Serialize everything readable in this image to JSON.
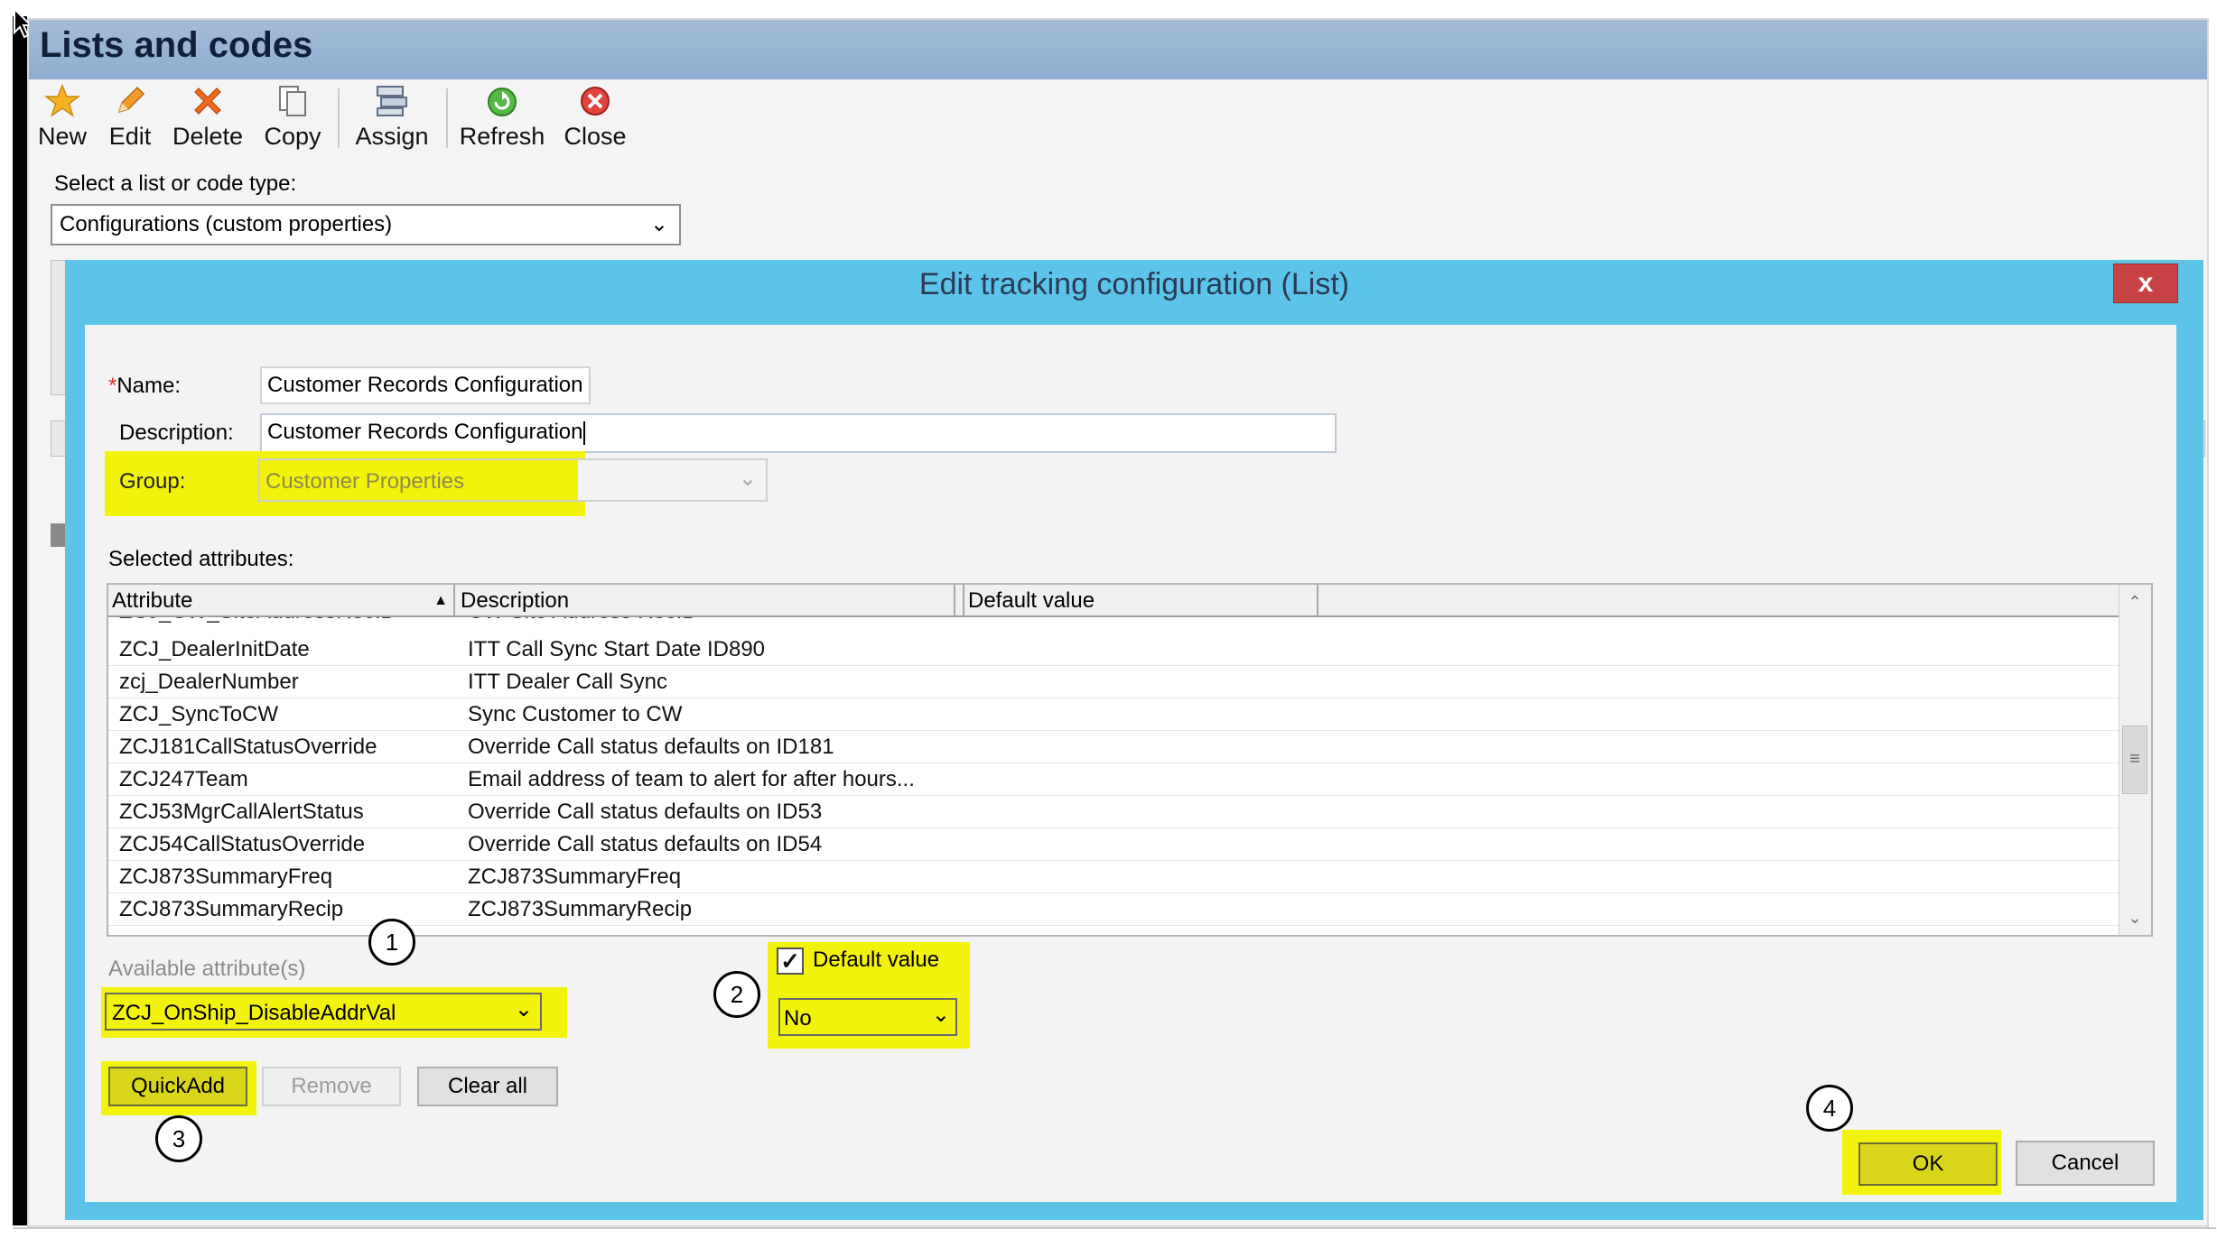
{
  "window": {
    "title": "Lists and codes"
  },
  "toolbar": {
    "new": "New",
    "edit": "Edit",
    "delete": "Delete",
    "copy": "Copy",
    "assign": "Assign",
    "refresh": "Refresh",
    "close": "Close"
  },
  "list_type": {
    "label": "Select a list or code type:",
    "value": "Configurations (custom properties)"
  },
  "dialog": {
    "title": "Edit tracking configuration (List)",
    "close_glyph": "x",
    "name_required_mark": "*",
    "name_label": "Name:",
    "name_value": "Customer Records Configuration",
    "description_label": "Description:",
    "description_value": "Customer Records Configuration",
    "group_label": "Group:",
    "group_value": "Customer Properties",
    "selected_attributes_label": "Selected attributes:",
    "grid": {
      "columns": [
        "Attribute",
        "Description",
        "Default value"
      ],
      "partial_row": {
        "attribute": "ZCJ_CW_SiteAddressRecID",
        "description": "CW Site Address RecID"
      },
      "rows": [
        {
          "attribute": "ZCJ_DealerInitDate",
          "description": "ITT Call Sync Start Date ID890"
        },
        {
          "attribute": "zcj_DealerNumber",
          "description": "ITT Dealer Call Sync"
        },
        {
          "attribute": "ZCJ_SyncToCW",
          "description": "Sync Customer to CW"
        },
        {
          "attribute": "ZCJ181CallStatusOverride",
          "description": "Override Call status defaults on ID181"
        },
        {
          "attribute": "ZCJ247Team",
          "description": "Email address of team to alert for after hours..."
        },
        {
          "attribute": "ZCJ53MgrCallAlertStatus",
          "description": "Override Call status defaults on ID53"
        },
        {
          "attribute": "ZCJ54CallStatusOverride",
          "description": "Override Call status defaults on ID54"
        },
        {
          "attribute": "ZCJ873SummaryFreq",
          "description": "ZCJ873SummaryFreq"
        },
        {
          "attribute": "ZCJ873SummaryRecip",
          "description": "ZCJ873SummaryRecip"
        }
      ]
    },
    "available_label": "Available attribute(s)",
    "available_value": "ZCJ_OnShip_DisableAddrVal",
    "default_value_checkbox_label": "Default value",
    "default_value_checked": true,
    "default_value_select": "No",
    "quickadd_label": "QuickAdd",
    "remove_label": "Remove",
    "clear_all_label": "Clear all",
    "ok_label": "OK",
    "cancel_label": "Cancel"
  },
  "callouts": [
    "1",
    "2",
    "3",
    "4"
  ],
  "colors": {
    "title_bar": "#9fb8d6",
    "dialog_frame": "#5cc4e8",
    "highlight": "#f3f20c",
    "close_button": "#c74343"
  },
  "icons": {
    "new": "star-icon",
    "edit": "pencil-icon",
    "delete": "x-icon",
    "copy": "document-copy-icon",
    "assign": "assign-stack-icon",
    "refresh": "refresh-icon",
    "close": "close-circle-icon"
  }
}
